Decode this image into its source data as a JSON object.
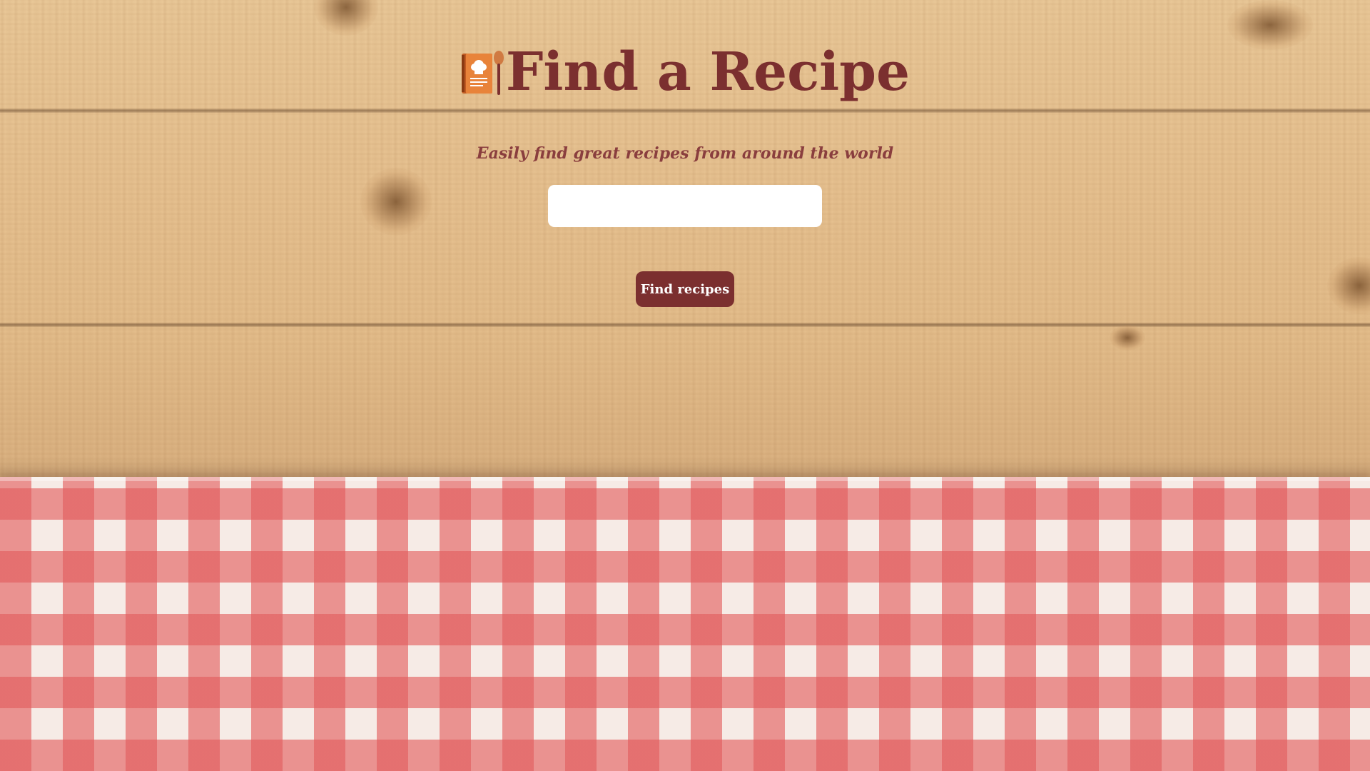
{
  "header": {
    "title": "Find a Recipe",
    "logo_icon": "cookbook-and-spoon-icon",
    "tagline": "Easily find great recipes from around the world"
  },
  "search": {
    "value": "",
    "placeholder": ""
  },
  "actions": {
    "find_label": "Find recipes"
  },
  "colors": {
    "brand": "#7b2f2f",
    "logo_accent": "#e8833a",
    "input_background": "#ffffff",
    "wood": "#e6c190",
    "cloth_check": "#e25c5c"
  }
}
